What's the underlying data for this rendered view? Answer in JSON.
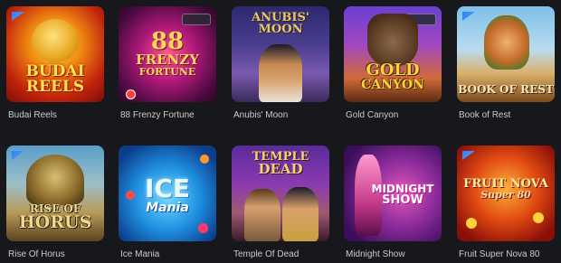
{
  "games": [
    {
      "title": "Budai Reels",
      "logo_lines": [
        "BUDAI",
        "REELS"
      ]
    },
    {
      "title": "88 Frenzy Fortune",
      "logo_lines": [
        "88",
        "FRENZY",
        "FORTUNE"
      ]
    },
    {
      "title": "Anubis' Moon",
      "logo_lines": [
        "ANUBIS'",
        "MOON"
      ]
    },
    {
      "title": "Gold Canyon",
      "logo_lines": [
        "GOLD",
        "CANYON"
      ]
    },
    {
      "title": "Book of Rest",
      "logo_lines": [
        "BOOK OF REST"
      ]
    },
    {
      "title": "Rise Of Horus",
      "logo_lines": [
        "RISE OF",
        "HORUS"
      ]
    },
    {
      "title": "Ice Mania",
      "logo_lines": [
        "ICE",
        "Mania"
      ]
    },
    {
      "title": "Temple Of Dead",
      "logo_lines": [
        "TEMPLE",
        "DEAD"
      ]
    },
    {
      "title": "Midnight Show",
      "logo_lines": [
        "MIDNIGHT",
        "SHOW"
      ]
    },
    {
      "title": "Fruit Super Nova 80",
      "logo_lines": [
        "FRUIT NOVA",
        "Super 80"
      ]
    }
  ],
  "colors": {
    "background": "#17181c",
    "title_text": "#c9cbd1"
  }
}
